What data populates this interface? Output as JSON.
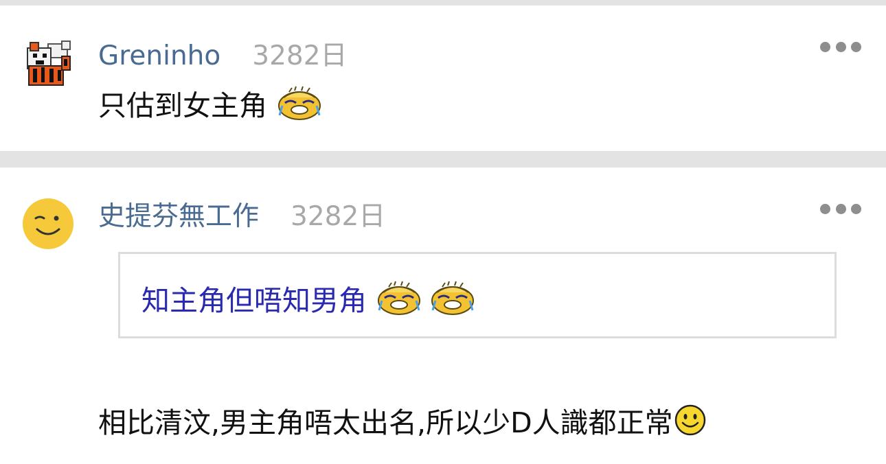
{
  "comments": [
    {
      "username": "Greninho",
      "timestamp": "3282日",
      "avatar_icon": "tiger-pixel-avatar-icon",
      "text": "只估到女主角",
      "emoji": [
        "crying-face-icon"
      ]
    },
    {
      "username": "史提芬無工作",
      "timestamp": "3282日",
      "avatar_icon": "smiley-face-avatar-icon",
      "quote": {
        "text": "知主角但唔知男角",
        "emoji": [
          "crying-face-icon",
          "crying-face-icon"
        ]
      },
      "text": "相比清汶,男主角唔太出名,所以少D人識都正常",
      "emoji": [
        "smile-icon"
      ]
    }
  ],
  "colors": {
    "username": "#4a6b91",
    "timestamp": "#a8a8a8",
    "quote_text": "#2a2ab0",
    "body_text": "#111111",
    "separator": "#e3e3e3"
  }
}
